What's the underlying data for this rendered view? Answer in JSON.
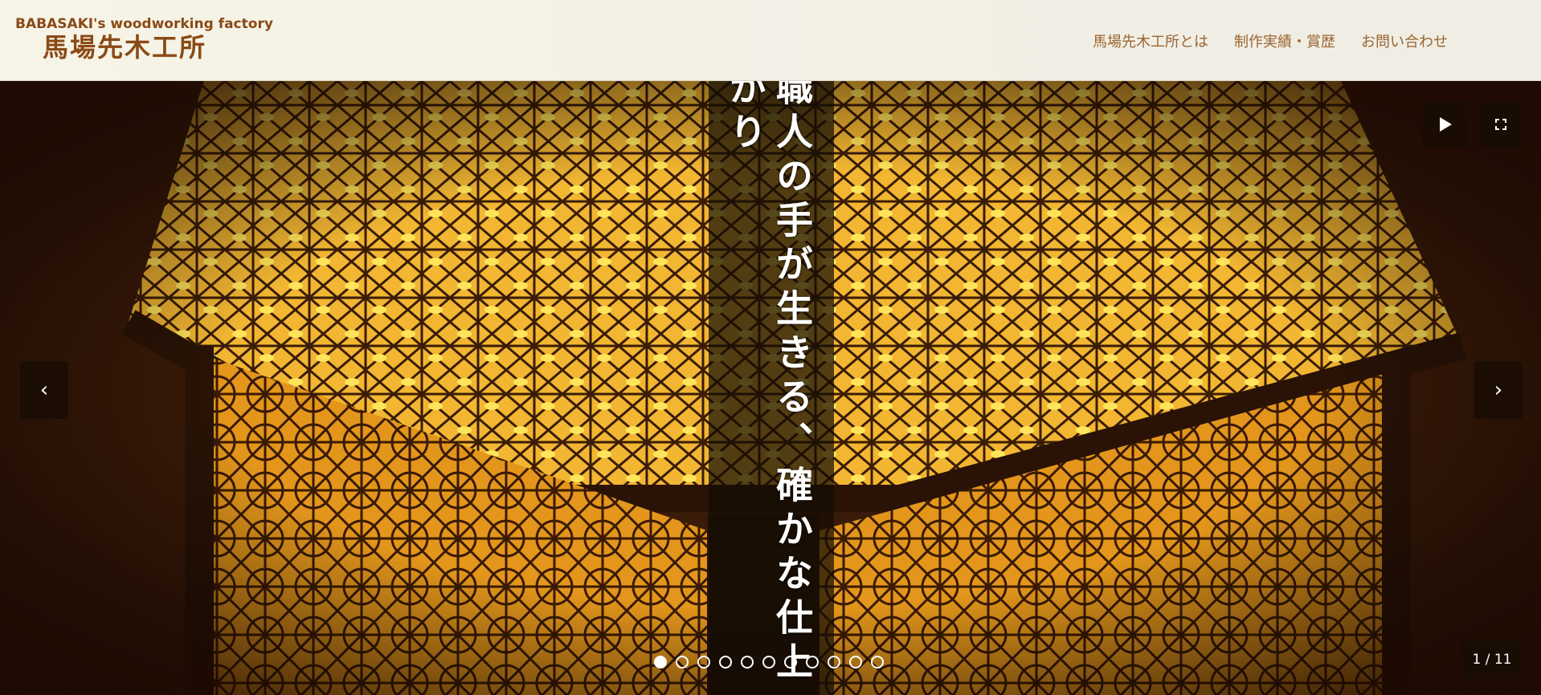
{
  "header": {
    "brand_sub": "BABASAKI's woodworking factory",
    "brand_main": "馬場先木工所",
    "nav": [
      {
        "label": "馬場先木工所とは"
      },
      {
        "label": "制作実績・賞歴"
      },
      {
        "label": "お問い合わせ"
      }
    ]
  },
  "slider": {
    "caption_col_1": "職人の手が生きる、確かな仕上",
    "caption_col_2": "がり",
    "counter": "1 / 11",
    "prev_label": "‹",
    "next_label": "›",
    "total_slides": 11,
    "active_index": 0
  }
}
